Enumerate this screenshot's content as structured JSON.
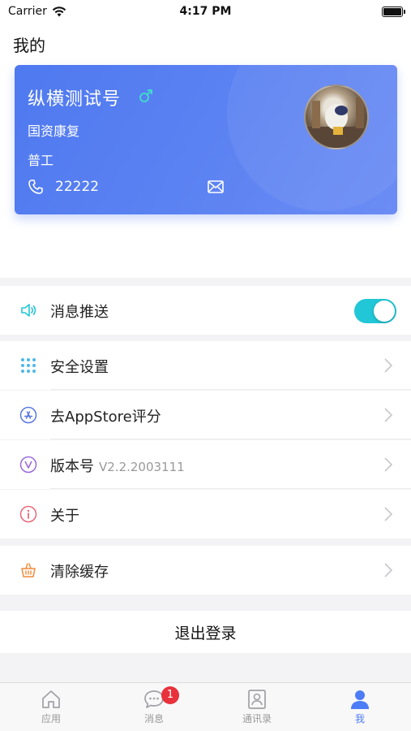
{
  "status_bar": {
    "carrier": "Carrier",
    "time": "4:17 PM"
  },
  "page": {
    "title": "我的"
  },
  "profile": {
    "name": "纵横测试号",
    "gender_symbol": "♂",
    "organization": "国资康复",
    "role": "普工",
    "phone": "22222",
    "avatar": "user-avatar"
  },
  "settings": {
    "push": {
      "label": "消息推送",
      "enabled": true,
      "icon": "speaker-icon"
    },
    "security": {
      "label": "安全设置",
      "icon": "grid-dots-icon"
    },
    "rate": {
      "label": "去AppStore评分",
      "icon": "appstore-icon"
    },
    "version": {
      "label": "版本号",
      "value": "V2.2.2003111",
      "icon": "v-circle-icon"
    },
    "about": {
      "label": "关于",
      "icon": "info-icon"
    },
    "cache": {
      "label": "清除缓存",
      "icon": "basket-icon"
    }
  },
  "logout_label": "退出登录",
  "tabbar": {
    "tabs": [
      {
        "label": "应用",
        "icon": "home-icon"
      },
      {
        "label": "消息",
        "icon": "chat-icon",
        "badge": "1"
      },
      {
        "label": "通讯录",
        "icon": "contacts-icon"
      },
      {
        "label": "我",
        "icon": "person-icon",
        "active": true
      }
    ]
  },
  "colors": {
    "accent": "#4d7df6",
    "toggle": "#21c7d6",
    "badge": "#e8323c"
  }
}
